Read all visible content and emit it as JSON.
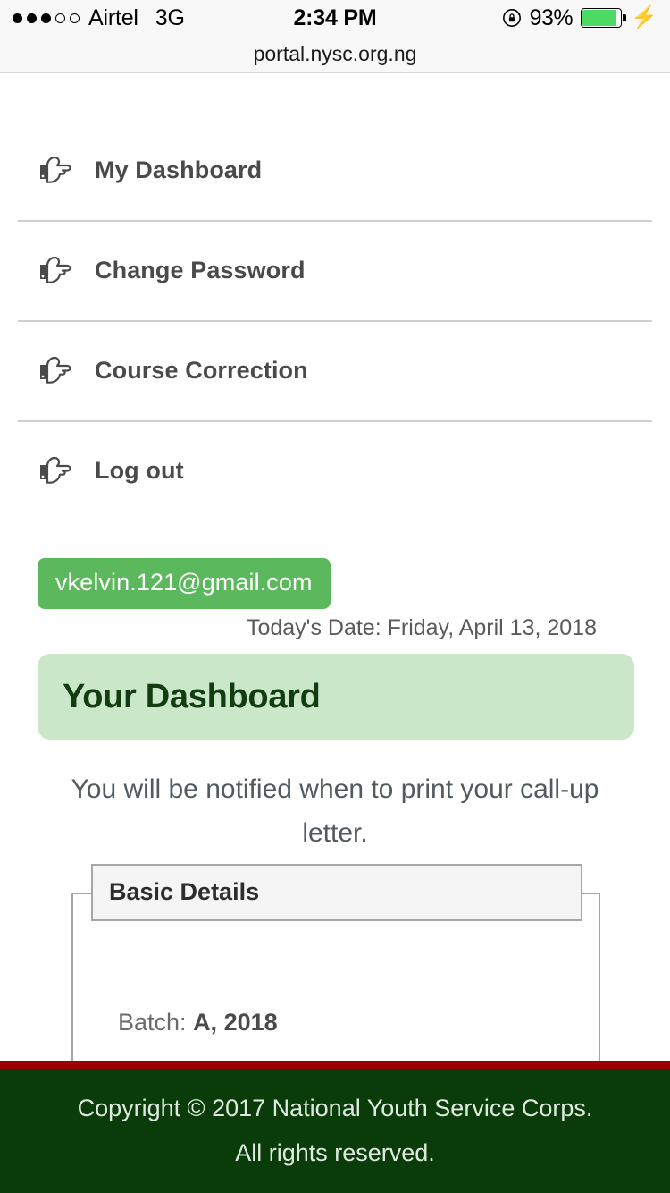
{
  "status_bar": {
    "signal_dots_total": 5,
    "signal_dots_filled": 3,
    "carrier": "Airtel",
    "network": "3G",
    "time": "2:34 PM",
    "battery_percent": "93%",
    "battery_level": 93,
    "rotation_lock_icon": "rotation-lock-icon",
    "charging_icon": "lightning-bolt-icon"
  },
  "browser": {
    "url": "portal.nysc.org.ng"
  },
  "nav": {
    "items": [
      {
        "label": "My Dashboard",
        "icon": "hand-point-right-icon"
      },
      {
        "label": "Change Password",
        "icon": "hand-point-right-icon"
      },
      {
        "label": "Course Correction",
        "icon": "hand-point-right-icon"
      },
      {
        "label": "Log out",
        "icon": "hand-point-right-icon"
      }
    ]
  },
  "account": {
    "email": "vkelvin.121@gmail.com",
    "today_date": "Today's Date: Friday, April 13, 2018"
  },
  "dashboard": {
    "title": "Your Dashboard",
    "notice": "You will be notified when to print your call-up letter."
  },
  "basic_details": {
    "legend": "Basic Details",
    "rows": [
      {
        "label": "Batch:",
        "value": "A, 2018"
      }
    ]
  },
  "footer": {
    "copyright": "Copyright © 2017 National Youth Service Corps. All rights reserved."
  },
  "colors": {
    "badge_green": "#5cb85c",
    "panel_light_green": "#cbe7c9",
    "panel_title_green": "#123d10",
    "footer_green": "#0a3c0a",
    "footer_rule_red": "#9b0000",
    "battery_green": "#4cd964",
    "divider_gray": "#cfcfcf",
    "text_gray": "#4a4a4a"
  }
}
